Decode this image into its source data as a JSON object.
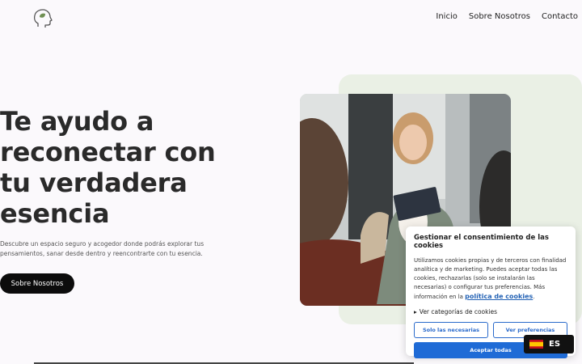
{
  "header": {
    "logo_icon": "head-leaf-logo-icon",
    "nav": [
      {
        "label": "Inicio"
      },
      {
        "label": "Sobre Nosotros"
      },
      {
        "label": "Contacto"
      }
    ]
  },
  "hero": {
    "title": "Te ayudo a reconectar con tu verdadera esencia",
    "description": "Descubre un espacio seguro y acogedor donde podrás explorar tus pensamientos, sanar desde dentro y reencontrarte con tu esencia.",
    "button_label": "Sobre Nosotros",
    "accent_bg": "#eaf0e5"
  },
  "cookie": {
    "title": "Gestionar el consentimiento de las cookies",
    "text": "Utilizamos cookies propias y de terceros con finalidad analítica y de marketing. Puedes aceptar todas las cookies, rechazarlas (solo se instalarán las necesarias) o configurar tus preferencias. Más información en la",
    "link_label": "política de cookies",
    "link_suffix": ".",
    "categories_label": "Ver categorías de cookies",
    "btn_necessary": "Solo las necesarias",
    "btn_preferences": "Ver preferencias",
    "btn_accept": "Aceptar todas",
    "accent": "#1f6bd6"
  },
  "language": {
    "code": "ES",
    "flag_icon": "spain-flag-icon"
  }
}
